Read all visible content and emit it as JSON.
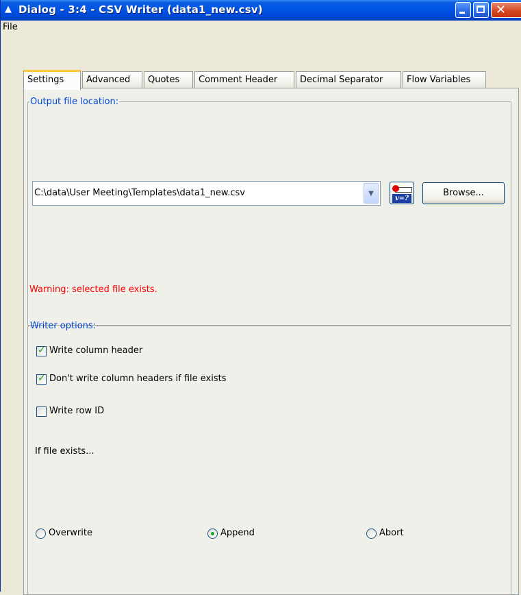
{
  "window": {
    "title": "Dialog - 3:4 - CSV Writer (data1_new.csv)",
    "buttons": [
      "minimize",
      "maximize",
      "close"
    ]
  },
  "menu": {
    "file": "File"
  },
  "tabs": [
    {
      "label": "Settings",
      "active": true
    },
    {
      "label": "Advanced",
      "active": false
    },
    {
      "label": "Quotes",
      "active": false
    },
    {
      "label": "Comment Header",
      "active": false
    },
    {
      "label": "Decimal Separator",
      "active": false
    },
    {
      "label": "Flow Variables",
      "active": false
    }
  ],
  "output_group": {
    "legend": "Output file location:",
    "path_value": "C:\\data\\User Meeting\\Templates\\data1_new.csv",
    "flow_variable_icon_text": "v=?",
    "browse_label": "Browse...",
    "warning": "Warning: selected file exists.",
    "warning_color": "#ff0000"
  },
  "writer_group": {
    "legend": "Writer options:",
    "checkboxes": [
      {
        "label": "Write column header",
        "checked": true
      },
      {
        "label": "Don't write column headers if file exists",
        "checked": true
      },
      {
        "label": "Write row ID",
        "checked": false
      }
    ],
    "if_exists_label": "If file exists...",
    "radios": [
      {
        "label": "Overwrite",
        "selected": false
      },
      {
        "label": "Append",
        "selected": true
      },
      {
        "label": "Abort",
        "selected": false
      }
    ]
  },
  "colors": {
    "titlebar": "#0055e5",
    "legend": "#0046d5",
    "active_tab_accent": "#ffc83c",
    "check": "#21a121"
  }
}
